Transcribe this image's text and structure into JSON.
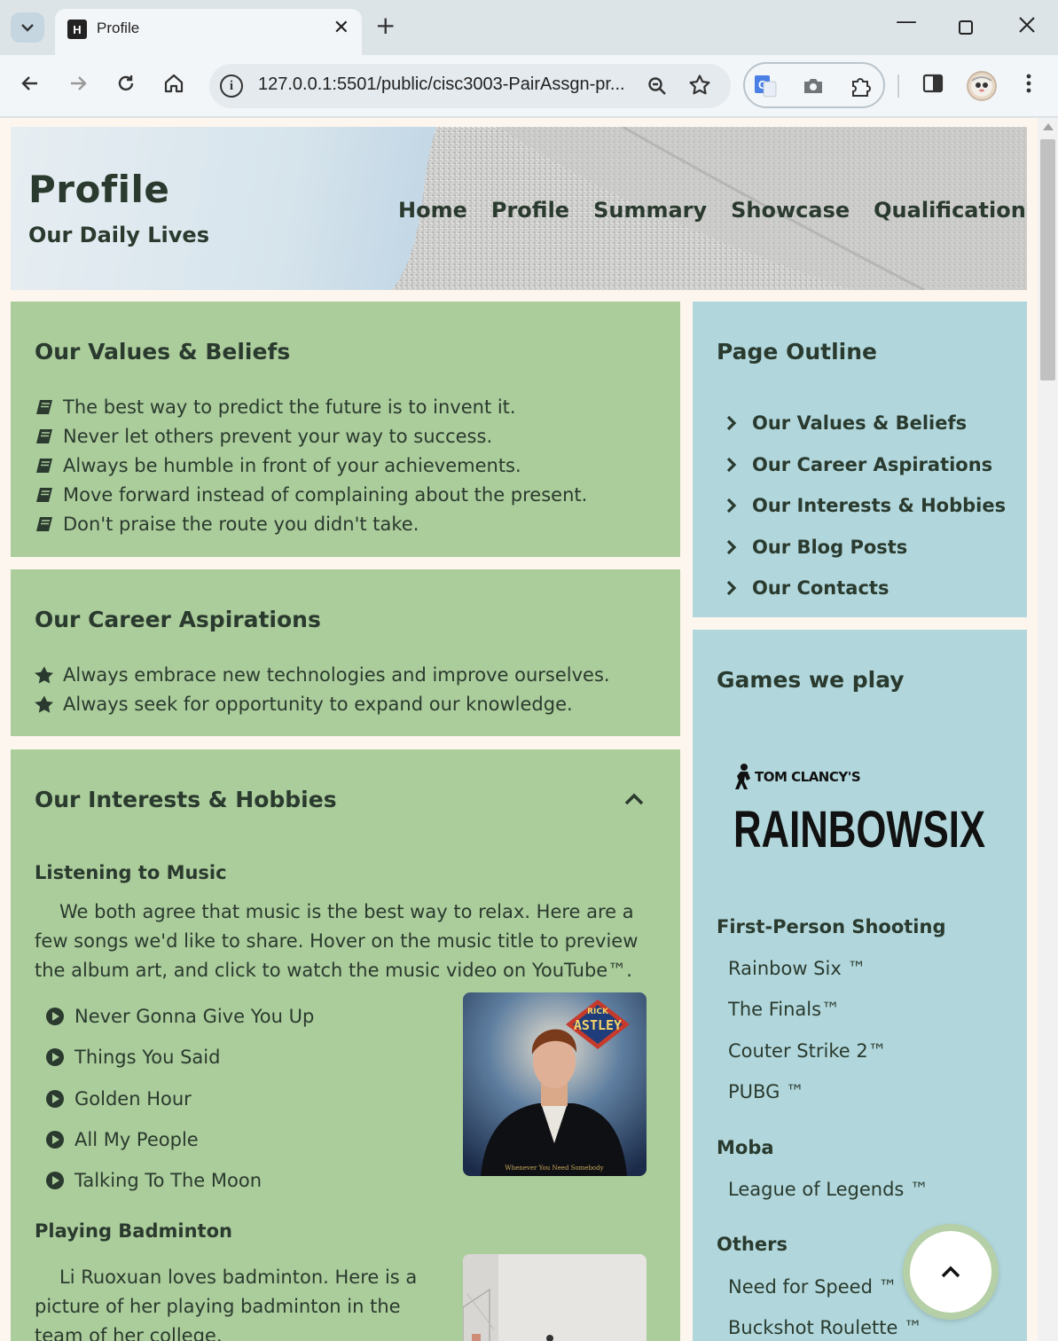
{
  "browser": {
    "tab_title": "Profile",
    "favicon_text": "H",
    "url": "127.0.0.1:5501/public/cisc3003-PairAssgn-pr...",
    "icons": [
      "tab-search-icon",
      "close-icon",
      "plus-icon",
      "minimize-icon",
      "maximize-icon",
      "window-close-icon",
      "back-arrow-icon",
      "forward-arrow-icon",
      "reload-icon",
      "home-icon",
      "site-info-icon",
      "zoom-icon",
      "star-icon",
      "translate-icon",
      "camera-icon",
      "puzzle-icon",
      "side-panel-icon",
      "profile-avatar-icon",
      "kebab-menu-icon"
    ]
  },
  "header": {
    "title": "Profile",
    "subtitle": "Our Daily Lives",
    "nav": [
      "Home",
      "Profile",
      "Summary",
      "Showcase",
      "Qualification"
    ]
  },
  "values": {
    "title": "Our Values & Beliefs",
    "items": [
      "The best way to predict the future is to invent it.",
      "Never let others prevent your way to success.",
      "Always be humble in front of your achievements.",
      "Move forward instead of complaining about the present.",
      "Don't praise the route you didn't take."
    ]
  },
  "career": {
    "title": "Our Career Aspirations",
    "items": [
      "Always embrace new technologies and improve ourselves.",
      "Always seek for opportunity to expand our knowledge."
    ]
  },
  "interests": {
    "title": "Our Interests & Hobbies",
    "music": {
      "heading": "Listening to Music",
      "intro": "We both agree that music is the best way to relax. Here are a few songs we'd like to share. Hover on the music title to preview the album art, and click to watch the music video on YouTube™.",
      "songs": [
        "Never Gonna Give You Up",
        "Things You Said",
        "Golden Hour",
        "All My People",
        "Talking To The Moon"
      ],
      "album_band": "RICK",
      "album_name": "ASTLEY",
      "album_tagline": "Whenever You Need Somebody"
    },
    "badminton": {
      "heading": "Playing Badminton",
      "text": "Li Ruoxuan loves badminton. Here is a picture of her playing badminton in the team of her college."
    }
  },
  "outline": {
    "title": "Page Outline",
    "items": [
      "Our Values & Beliefs",
      "Our Career Aspirations",
      "Our Interests & Hobbies",
      "Our Blog Posts",
      "Our Contacts"
    ]
  },
  "games": {
    "title": "Games we play",
    "logo_top": "TOM CLANCY'S",
    "logo_main": "RAINBOWSIX",
    "categories": [
      {
        "name": "First-Person Shooting",
        "items": [
          "Rainbow Six ™",
          "The Finals™",
          "Couter Strike 2™",
          "PUBG ™"
        ]
      },
      {
        "name": "Moba",
        "items": [
          "League of Legends ™"
        ]
      },
      {
        "name": "Others",
        "items": [
          "Need for Speed ™",
          "Buckshot Roulette ™"
        ]
      }
    ]
  },
  "colors": {
    "green_card": "#abcc9b",
    "blue_card": "#b1d7dc",
    "text": "#2a3a2e",
    "page_bg": "#fdf6ee"
  }
}
